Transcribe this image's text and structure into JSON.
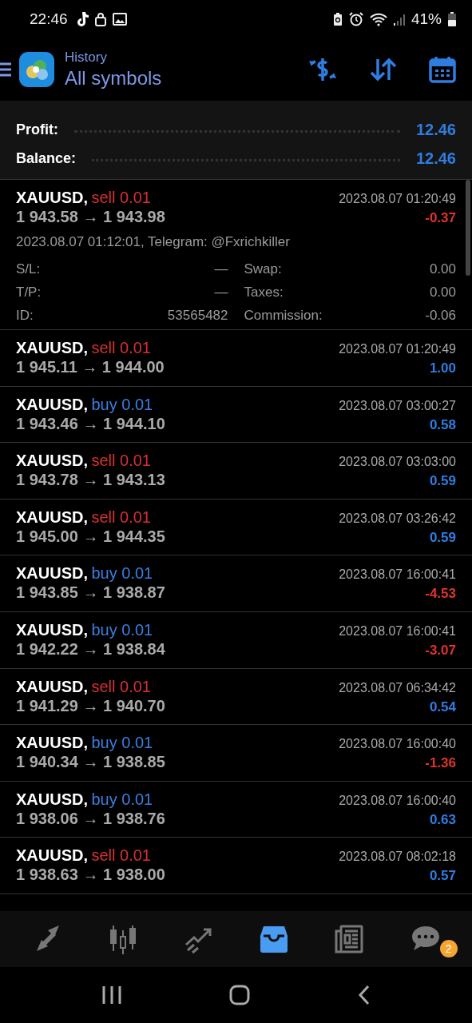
{
  "status_bar": {
    "time": "22:46",
    "battery": "41%"
  },
  "header": {
    "section": "History",
    "title": "All symbols"
  },
  "summary": [
    {
      "label": "Profit:",
      "value": "12.46"
    },
    {
      "label": "Balance:",
      "value": "12.46"
    }
  ],
  "deals": [
    {
      "symbol": "XAUUSD,",
      "kind": "sell",
      "deal": "sell 0.01",
      "prices": "1 943.58 → 1 943.98",
      "time": "2023.08.07 01:20:49",
      "profit": "-0.37",
      "loss": true,
      "expanded": true,
      "opened": "2023.08.07 01:12:01, Telegram: @Fxrichkiller",
      "details": [
        {
          "label": "S/L:",
          "value": "—"
        },
        {
          "label": "Swap:",
          "value": "0.00"
        },
        {
          "label": "T/P:",
          "value": "—"
        },
        {
          "label": "Taxes:",
          "value": "0.00"
        },
        {
          "label": "ID:",
          "value": "53565482"
        },
        {
          "label": "Commission:",
          "value": "-0.06"
        }
      ]
    },
    {
      "symbol": "XAUUSD,",
      "kind": "sell",
      "deal": "sell 0.01",
      "prices": "1 945.11 → 1 944.00",
      "time": "2023.08.07 01:20:49",
      "profit": "1.00",
      "loss": false,
      "expanded": false
    },
    {
      "symbol": "XAUUSD,",
      "kind": "buy",
      "deal": "buy 0.01",
      "prices": "1 943.46 → 1 944.10",
      "time": "2023.08.07 03:00:27",
      "profit": "0.58",
      "loss": false,
      "expanded": false
    },
    {
      "symbol": "XAUUSD,",
      "kind": "sell",
      "deal": "sell 0.01",
      "prices": "1 943.78 → 1 943.13",
      "time": "2023.08.07 03:03:00",
      "profit": "0.59",
      "loss": false,
      "expanded": false
    },
    {
      "symbol": "XAUUSD,",
      "kind": "sell",
      "deal": "sell 0.01",
      "prices": "1 945.00 → 1 944.35",
      "time": "2023.08.07 03:26:42",
      "profit": "0.59",
      "loss": false,
      "expanded": false
    },
    {
      "symbol": "XAUUSD,",
      "kind": "buy",
      "deal": "buy 0.01",
      "prices": "1 943.85 → 1 938.87",
      "time": "2023.08.07 16:00:41",
      "profit": "-4.53",
      "loss": true,
      "expanded": false
    },
    {
      "symbol": "XAUUSD,",
      "kind": "buy",
      "deal": "buy 0.01",
      "prices": "1 942.22 → 1 938.84",
      "time": "2023.08.07 16:00:41",
      "profit": "-3.07",
      "loss": true,
      "expanded": false
    },
    {
      "symbol": "XAUUSD,",
      "kind": "sell",
      "deal": "sell 0.01",
      "prices": "1 941.29 → 1 940.70",
      "time": "2023.08.07 06:34:42",
      "profit": "0.54",
      "loss": false,
      "expanded": false
    },
    {
      "symbol": "XAUUSD,",
      "kind": "buy",
      "deal": "buy 0.01",
      "prices": "1 940.34 → 1 938.85",
      "time": "2023.08.07 16:00:40",
      "profit": "-1.36",
      "loss": true,
      "expanded": false
    },
    {
      "symbol": "XAUUSD,",
      "kind": "buy",
      "deal": "buy 0.01",
      "prices": "1 938.06 → 1 938.76",
      "time": "2023.08.07 16:00:40",
      "profit": "0.63",
      "loss": false,
      "expanded": false
    },
    {
      "symbol": "XAUUSD,",
      "kind": "sell",
      "deal": "sell 0.01",
      "prices": "1 938.63 → 1 938.00",
      "time": "2023.08.07 08:02:18",
      "profit": "0.57",
      "loss": false,
      "expanded": false
    }
  ],
  "bottom_nav": [
    {
      "kind": "quotes",
      "selected": false
    },
    {
      "kind": "chart",
      "selected": false
    },
    {
      "kind": "trade",
      "selected": false
    },
    {
      "kind": "history",
      "selected": true
    },
    {
      "kind": "news",
      "selected": false
    },
    {
      "kind": "chat",
      "selected": false,
      "badge": "2"
    }
  ]
}
